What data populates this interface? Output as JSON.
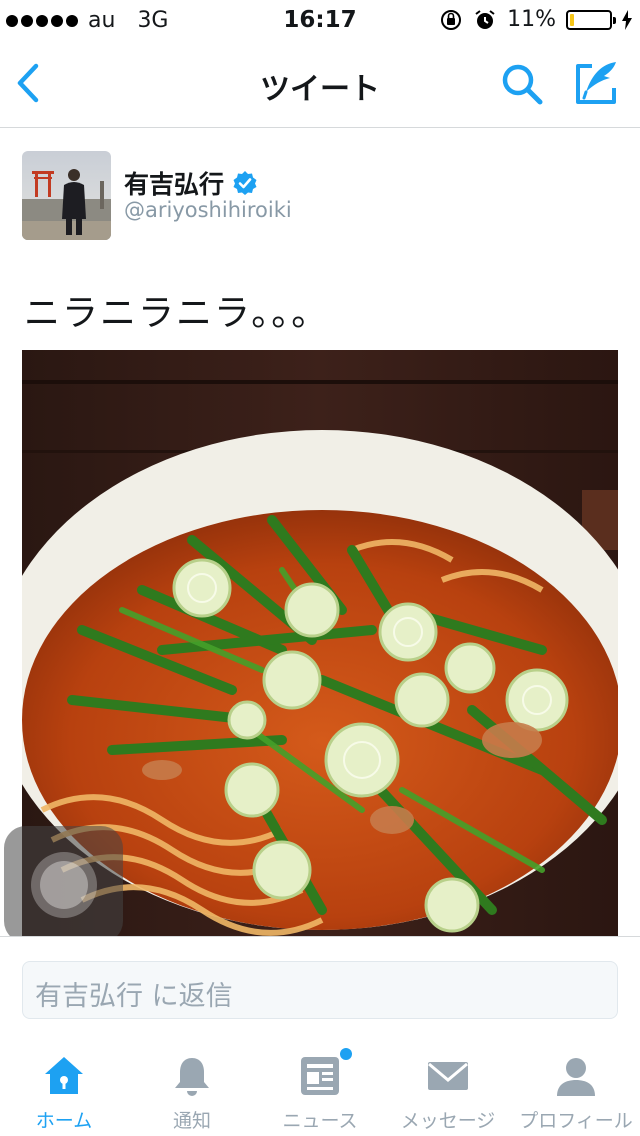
{
  "status_bar": {
    "carrier": "au",
    "network": "3G",
    "time": "16:17",
    "battery_text": "11%",
    "battery_level": 0.11,
    "battery_color": "#f5c518"
  },
  "nav": {
    "title": "ツイート",
    "back_icon": "chevron-left-icon",
    "search_icon": "search-icon",
    "compose_icon": "compose-tweet-icon"
  },
  "tweet": {
    "user_name": "有吉弘行",
    "verified": true,
    "handle": "@ariyoshihiroiki",
    "text": "ニラニラニラ。。。"
  },
  "reply": {
    "placeholder": "有吉弘行 に返信"
  },
  "tabs": [
    {
      "label": "ホーム",
      "icon": "home-icon",
      "active": true
    },
    {
      "label": "通知",
      "icon": "bell-icon",
      "active": false
    },
    {
      "label": "ニュース",
      "icon": "news-icon",
      "active": false,
      "badge_dot": true
    },
    {
      "label": "メッセージ",
      "icon": "envelope-icon",
      "active": false
    },
    {
      "label": "プロフィール",
      "icon": "person-icon",
      "active": false
    }
  ],
  "colors": {
    "accent": "#1da1f2",
    "inactive": "#9aa7b2"
  }
}
